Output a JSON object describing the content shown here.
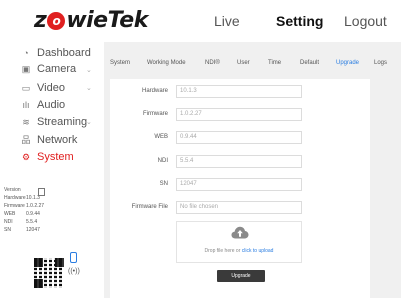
{
  "header": {
    "logo_part1": "z",
    "logo_o": "o",
    "logo_part2": "wie",
    "logo_part3": "Tek",
    "nav": {
      "live": "Live",
      "setting": "Setting",
      "logout": "Logout"
    }
  },
  "sidebar": {
    "items": [
      {
        "label": "Dashboard",
        "icon": "gauge-icon",
        "active": false
      },
      {
        "label": "Camera",
        "icon": "camera-icon",
        "active": false,
        "chevron": true
      },
      {
        "label": "Video",
        "icon": "video-icon",
        "active": false,
        "chevron": true
      },
      {
        "label": "Audio",
        "icon": "audio-icon",
        "active": false
      },
      {
        "label": "Streaming",
        "icon": "streaming-icon",
        "active": false,
        "chevron": true
      },
      {
        "label": "Network",
        "icon": "network-icon",
        "active": false
      },
      {
        "label": "System",
        "icon": "gear-icon",
        "active": true
      }
    ],
    "info": {
      "version_label": "Version",
      "rows": [
        {
          "k": "Hardware",
          "v": "10.1.3"
        },
        {
          "k": "Firmware",
          "v": "1.0.2.27"
        },
        {
          "k": "WEB",
          "v": "0.9.44"
        },
        {
          "k": "NDI",
          "v": "5.5.4"
        },
        {
          "k": "SN",
          "v": "12047"
        }
      ]
    }
  },
  "tabs": [
    "System",
    "Working Mode",
    "NDI®",
    "User",
    "Time",
    "Default",
    "Upgrade",
    "Logs"
  ],
  "active_tab": "Upgrade",
  "form": {
    "hardware": {
      "label": "Hardware",
      "value": "10.1.3"
    },
    "firmware": {
      "label": "Firmware",
      "value": "1.0.2.27"
    },
    "web": {
      "label": "WEB",
      "value": "0.9.44"
    },
    "ndi": {
      "label": "NDI",
      "value": "5.5.4"
    },
    "sn": {
      "label": "SN",
      "value": "12047"
    },
    "firmware_file": {
      "label": "Firmware File",
      "placeholder": "No file chosen"
    }
  },
  "dropzone": {
    "text": "Drop file here or ",
    "link": "click to upload"
  },
  "upgrade_button": "Upgrade",
  "colors": {
    "accent": "#e02020",
    "link": "#2a7de1"
  }
}
